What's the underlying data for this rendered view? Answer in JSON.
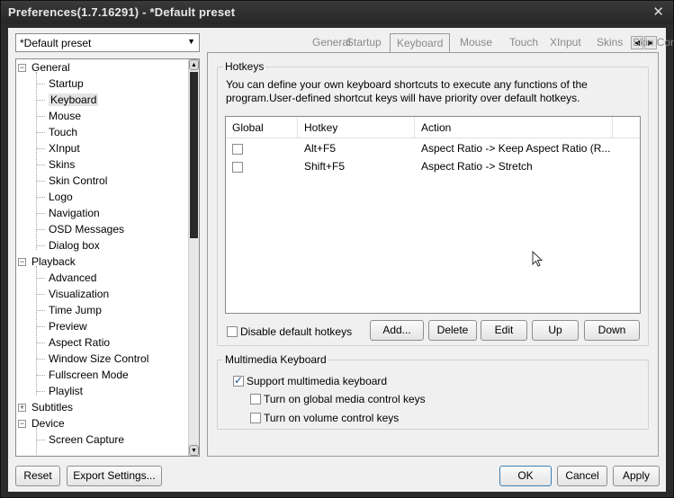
{
  "window": {
    "title": "Preferences(1.7.16291) - *Default preset",
    "close_glyph": "✕"
  },
  "preset": {
    "value": "*Default preset"
  },
  "tree": {
    "items": [
      {
        "label": "General",
        "level": 0,
        "expand": "−"
      },
      {
        "label": "Startup",
        "level": 1
      },
      {
        "label": "Keyboard",
        "level": 1,
        "selected": true
      },
      {
        "label": "Mouse",
        "level": 1
      },
      {
        "label": "Touch",
        "level": 1
      },
      {
        "label": "XInput",
        "level": 1
      },
      {
        "label": "Skins",
        "level": 1
      },
      {
        "label": "Skin Control",
        "level": 1
      },
      {
        "label": "Logo",
        "level": 1
      },
      {
        "label": "Navigation",
        "level": 1
      },
      {
        "label": "OSD Messages",
        "level": 1
      },
      {
        "label": "Dialog box",
        "level": 1
      },
      {
        "label": "Playback",
        "level": 0,
        "expand": "−"
      },
      {
        "label": "Advanced",
        "level": 1
      },
      {
        "label": "Visualization",
        "level": 1
      },
      {
        "label": "Time Jump",
        "level": 1
      },
      {
        "label": "Preview",
        "level": 1
      },
      {
        "label": "Aspect Ratio",
        "level": 1
      },
      {
        "label": "Window Size Control",
        "level": 1
      },
      {
        "label": "Fullscreen Mode",
        "level": 1
      },
      {
        "label": "Playlist",
        "level": 1
      },
      {
        "label": "Subtitles",
        "level": 0,
        "expand": "+"
      },
      {
        "label": "Device",
        "level": 0,
        "expand": "−"
      },
      {
        "label": "Screen Capture",
        "level": 1
      }
    ]
  },
  "tabs": [
    "General",
    "Startup",
    "Keyboard",
    "Mouse",
    "Touch",
    "XInput",
    "Skins",
    "Skin Control"
  ],
  "active_tab": "Keyboard",
  "hotkeys": {
    "legend": "Hotkeys",
    "description": "You can define your own keyboard shortcuts to execute any functions of the program.User-defined shortcut keys will have priority over default hotkeys.",
    "columns": [
      "Global",
      "Hotkey",
      "Action"
    ],
    "rows": [
      {
        "global": false,
        "hotkey": "Alt+F5",
        "action": "Aspect Ratio -> Keep Aspect Ratio (R..."
      },
      {
        "global": false,
        "hotkey": "Shift+F5",
        "action": "Aspect Ratio -> Stretch"
      }
    ],
    "disable_default": {
      "label": "Disable default hotkeys",
      "checked": false
    },
    "buttons": {
      "add": "Add...",
      "delete": "Delete",
      "edit": "Edit",
      "up": "Up",
      "down": "Down"
    }
  },
  "multimedia": {
    "legend": "Multimedia Keyboard",
    "support": {
      "label": "Support multimedia keyboard",
      "checked": true
    },
    "global_media": {
      "label": "Turn on global media control keys",
      "checked": false
    },
    "volume": {
      "label": "Turn on volume control keys",
      "checked": false
    }
  },
  "footer": {
    "reset": "Reset",
    "export": "Export Settings...",
    "ok": "OK",
    "cancel": "Cancel",
    "apply": "Apply"
  }
}
